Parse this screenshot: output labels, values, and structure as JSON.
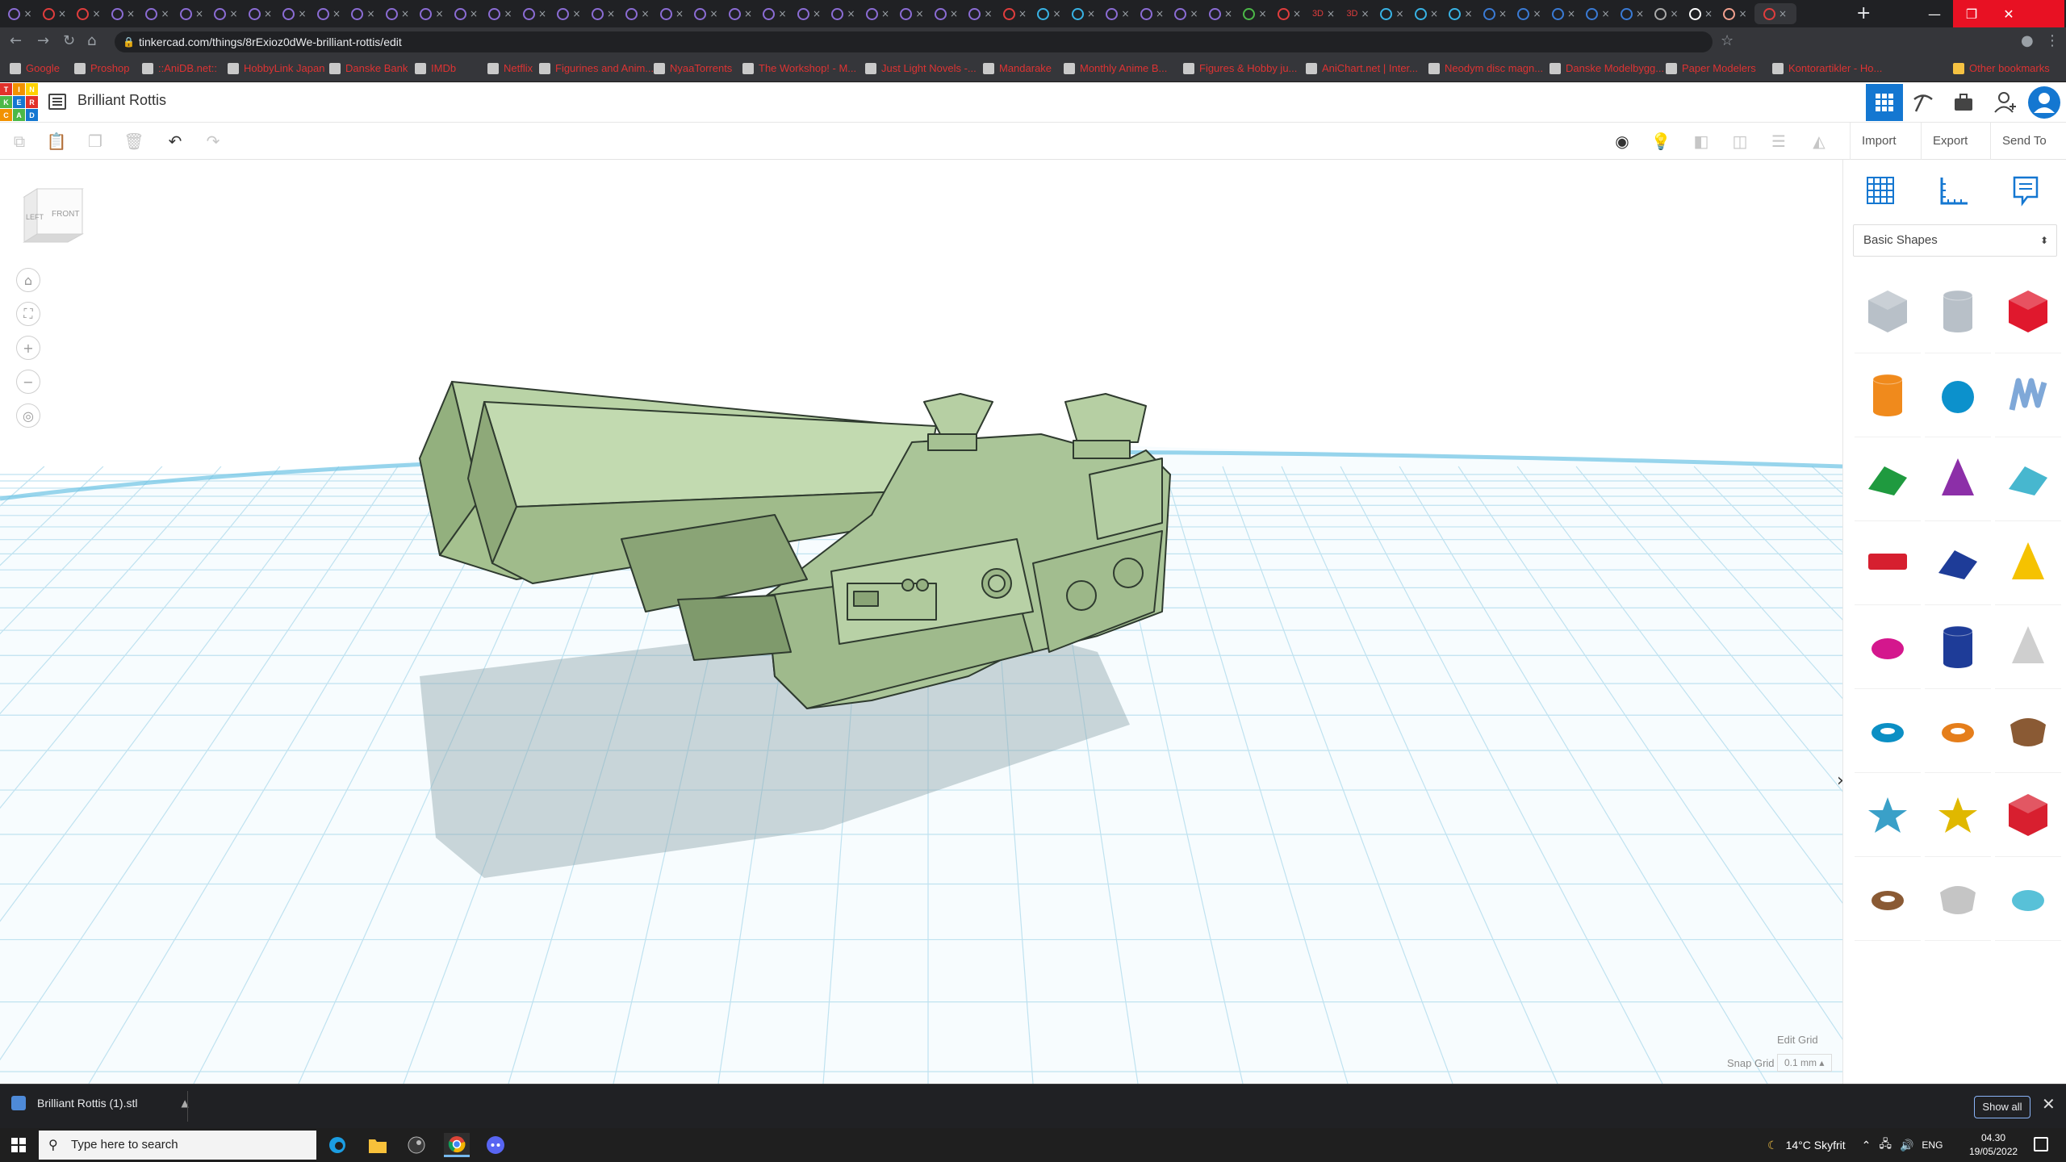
{
  "browser": {
    "url": "tinkercad.com/things/8rExioz0dWe-brilliant-rottis/edit",
    "bookmarks": [
      "Google",
      "Proshop",
      "::AniDB.net::",
      "HobbyLink Japan",
      "Danske Bank",
      "IMDb",
      "Netflix",
      "Figurines and Anim...",
      "NyaaTorrents",
      "The Workshop! - M...",
      "Just Light Novels -...",
      "Mandarake",
      "Monthly Anime B...",
      "Figures & Hobby ju...",
      "AniChart.net | Inter...",
      "Neodym disc magn...",
      "Danske Modelbygg...",
      "Paper Modelers",
      "Kontorartikler - Ho...",
      "Other bookmarks"
    ],
    "tab_badges": [
      "3D",
      "3D"
    ],
    "tab_close": "×",
    "newtab": "+",
    "window": {
      "minimize": "—",
      "restore": "❐",
      "close": "✕"
    }
  },
  "tinkercad": {
    "logo_letters": [
      "T",
      "I",
      "N",
      "K",
      "E",
      "R",
      "C",
      "A",
      "D"
    ],
    "logo_colors": [
      "#e2312a",
      "#f29200",
      "#ffd200",
      "#4cb848",
      "#1477d1",
      "#e2312a",
      "#f29200",
      "#4cb848",
      "#1477d1"
    ],
    "doc_title": "Brilliant Rottis",
    "toolbar": {
      "import": "Import",
      "export": "Export",
      "send_to": "Send To"
    },
    "viewcube": {
      "left": "LEFT",
      "front": "FRONT"
    },
    "grid": {
      "edit_label": "Edit Grid",
      "snap_label": "Snap Grid",
      "snap_value": "0.1 mm ▴"
    },
    "panel": {
      "category": "Basic Shapes",
      "shapes": [
        {
          "name": "box-hole",
          "color": "#b8c0c8"
        },
        {
          "name": "cylinder-hole",
          "color": "#b8c0c8"
        },
        {
          "name": "box",
          "color": "#e0182d"
        },
        {
          "name": "cylinder",
          "color": "#f08a1c"
        },
        {
          "name": "sphere",
          "color": "#0c91cc"
        },
        {
          "name": "scribble",
          "color": "#7fa8d8"
        },
        {
          "name": "roof",
          "color": "#1f9a3f"
        },
        {
          "name": "cone",
          "color": "#8c2fa8"
        },
        {
          "name": "round-roof",
          "color": "#47b7cf"
        },
        {
          "name": "text",
          "color": "#d61f2f"
        },
        {
          "name": "wedge",
          "color": "#1e3c98"
        },
        {
          "name": "pyramid",
          "color": "#f5c200"
        },
        {
          "name": "half-sphere",
          "color": "#d4178d"
        },
        {
          "name": "polygon",
          "color": "#1e3c98"
        },
        {
          "name": "paraboloid",
          "color": "#cfcfcf"
        },
        {
          "name": "torus",
          "color": "#0b8fc4"
        },
        {
          "name": "tube",
          "color": "#e57e1b"
        },
        {
          "name": "shape-generator",
          "color": "#8a5a34"
        },
        {
          "name": "star",
          "color": "#3aa0c8"
        },
        {
          "name": "star-gold",
          "color": "#e0b800"
        },
        {
          "name": "icosahedron",
          "color": "#d81f2f"
        },
        {
          "name": "ring",
          "color": "#8a5a34"
        },
        {
          "name": "heart-hole",
          "color": "#c5c5c5"
        },
        {
          "name": "ellipsoid",
          "color": "#58c1d8"
        }
      ]
    }
  },
  "download": {
    "file": "Brilliant Rottis (1).stl",
    "show_all": "Show all",
    "close": "✕"
  },
  "taskbar": {
    "search_placeholder": "Type here to search",
    "weather": "14°C  Skyfrit",
    "lang": "ENG",
    "time": "04.30",
    "date": "19/05/2022"
  },
  "model": {
    "color": "#a7c593"
  }
}
